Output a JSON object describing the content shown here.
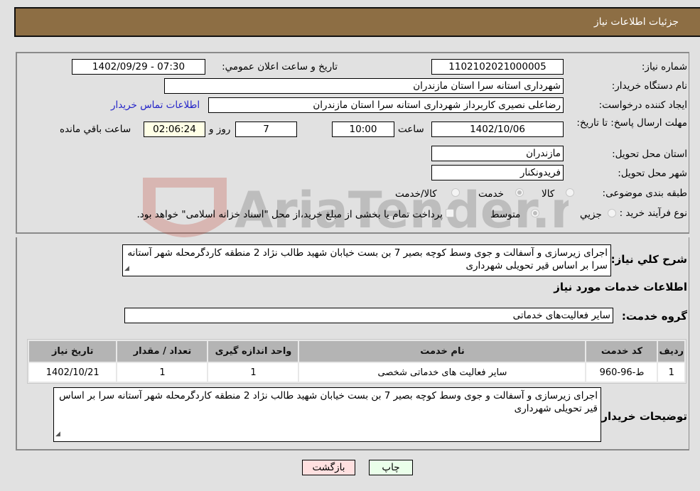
{
  "header": {
    "title": "جزئیات اطلاعات نیاز"
  },
  "fields": {
    "need_number": {
      "label": "شماره نیاز:",
      "value": "1102102021000005"
    },
    "announce": {
      "label": "تاریخ و ساعت اعلان عمومي:",
      "value": "1402/09/29 - 07:30"
    },
    "buyer_org": {
      "label": "نام دستگاه خریدار:",
      "value": "شهرداری استانه سرا استان مازندران"
    },
    "creator": {
      "label": "ایجاد کننده درخواست:",
      "value": "رضاعلی نصیری کاربرداز شهرداری استانه سرا استان مازندران"
    },
    "contact_link": "اطلاعات تماس خریدار",
    "deadline": {
      "label": "مهلت ارسال پاسخ: تا تاریخ:",
      "date": "1402/10/06",
      "time_label": "ساعت",
      "time": "10:00",
      "days": "7",
      "days_label": "روز و",
      "remaining": "02:06:24",
      "remaining_label": "ساعت باقي مانده"
    },
    "province": {
      "label": "استان محل تحویل:",
      "value": "مازندران"
    },
    "city": {
      "label": "شهر محل تحویل:",
      "value": "فریدونکنار"
    },
    "category": {
      "label": "طبقه بندی موضوعی:",
      "options": [
        "کالا",
        "خدمت",
        "کالا/خدمت"
      ],
      "selected": "خدمت"
    },
    "process": {
      "label": "نوع فرآیند خرید :",
      "options": [
        "جزيي",
        "متوسط"
      ],
      "selected": "متوسط",
      "treasury_note": "پرداخت تمام یا بخشی از مبلغ خرید،از محل \"اسناد خزانه اسلامی\" خواهد بود."
    }
  },
  "description": {
    "label": "شرح کلي نیاز:",
    "value": "اجرای زیرسازی و آسفالت و جوی وسط کوچه بصیر 7 بن بست خیابان شهید طالب نژاد 2 منطقه کاردگرمحله شهر آستانه سرا بر اساس قیر تحویلی شهرداری"
  },
  "services": {
    "section_title": "اطلاعات خدمات مورد نیاز",
    "group_label": "گروه خدمت:",
    "group_value": "سایر فعالیت‌های خدماتی",
    "table": {
      "headers": [
        "ردیف",
        "کد خدمت",
        "نام خدمت",
        "واحد اندازه گیری",
        "تعداد / مقدار",
        "تاریخ نیاز"
      ],
      "rows": [
        [
          "1",
          "ط-96-960",
          "سایر فعالیت های خدماتی شخصی",
          "1",
          "1",
          "1402/10/21"
        ]
      ]
    }
  },
  "buyer_notes": {
    "label": "توضیحات خریدار:",
    "value": "اجرای زیرسازی و آسفالت و جوی وسط کوچه بصیر 7 بن بست خیابان شهید طالب نژاد 2 منطقه کاردگرمحله شهر آستانه سرا بر اساس قیر تحویلی شهرداری"
  },
  "buttons": {
    "print": "چاپ",
    "back": "بازگشت"
  },
  "colors": {
    "header_bg": "#8d6e44",
    "print_bg": "#eaffea",
    "back_bg": "#ffe0e0",
    "link": "#2323c8"
  }
}
